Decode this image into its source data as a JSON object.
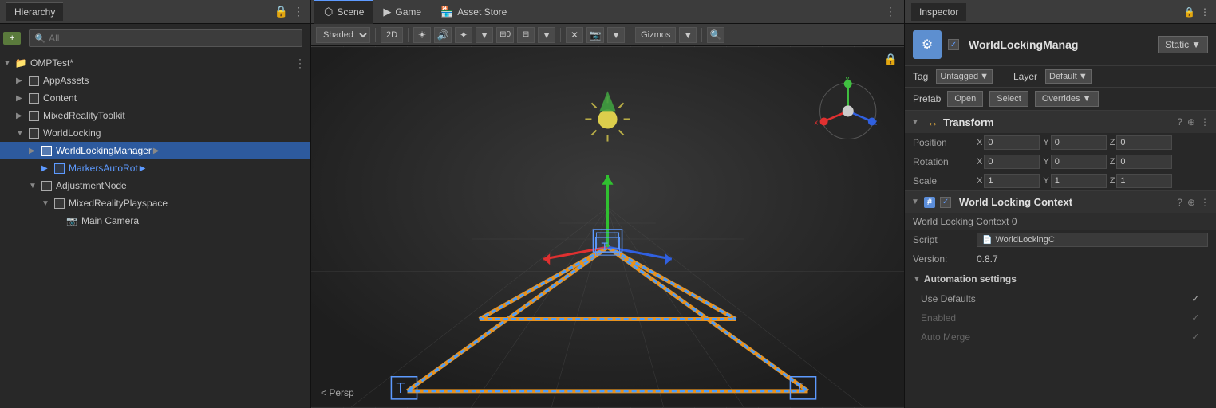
{
  "hierarchy": {
    "tab_label": "Hierarchy",
    "search_placeholder": "All",
    "root_item": "OMPTest*",
    "items": [
      {
        "id": "appassets",
        "label": "AppAssets",
        "depth": 1,
        "has_children": true,
        "type": "folder"
      },
      {
        "id": "content",
        "label": "Content",
        "depth": 1,
        "has_children": true,
        "type": "folder"
      },
      {
        "id": "mixedreality",
        "label": "MixedRealityToolkit",
        "depth": 1,
        "has_children": true,
        "type": "folder"
      },
      {
        "id": "worldlocking",
        "label": "WorldLocking",
        "depth": 1,
        "has_children": true,
        "type": "folder"
      },
      {
        "id": "worldlockingmanager",
        "label": "WorldLockingManager",
        "depth": 2,
        "has_children": true,
        "type": "prefab",
        "selected": true
      },
      {
        "id": "markersautorot",
        "label": "MarkersAutoRot",
        "depth": 3,
        "has_children": true,
        "type": "prefab_blue"
      },
      {
        "id": "adjustmentnode",
        "label": "AdjustmentNode",
        "depth": 2,
        "has_children": true,
        "type": "folder"
      },
      {
        "id": "mixedrealityplayspace",
        "label": "MixedRealityPlayspace",
        "depth": 3,
        "has_children": true,
        "type": "folder"
      },
      {
        "id": "maincamera",
        "label": "Main Camera",
        "depth": 4,
        "has_children": false,
        "type": "camera"
      }
    ]
  },
  "scene": {
    "tabs": [
      {
        "id": "scene",
        "label": "Scene",
        "icon": "⬡",
        "active": true
      },
      {
        "id": "game",
        "label": "Game",
        "icon": "🎮",
        "active": false
      },
      {
        "id": "assetstore",
        "label": "Asset Store",
        "icon": "🏪",
        "active": false
      }
    ],
    "toolbar": {
      "shading": "Shaded",
      "mode_2d": "2D",
      "audio_label": "0",
      "gizmos_label": "Gizmos"
    },
    "perspective_label": "< Persp"
  },
  "inspector": {
    "tab_label": "Inspector",
    "lock_icon": "🔒",
    "object_name": "WorldLockingManag",
    "static_label": "Static",
    "tag_label": "Tag",
    "tag_value": "Untagged",
    "layer_label": "Layer",
    "layer_value": "Default",
    "prefab_label": "Prefab",
    "open_label": "Open",
    "select_label": "Select",
    "overrides_label": "Overrides",
    "transform": {
      "section_name": "Transform",
      "position_label": "Position",
      "rotation_label": "Rotation",
      "scale_label": "Scale",
      "pos_x": "0",
      "pos_y": "0",
      "pos_z": "0",
      "rot_x": "0",
      "rot_y": "0",
      "rot_z": "0",
      "scale_x": "1",
      "scale_y": "1",
      "scale_z": "1"
    },
    "world_locking_context": {
      "section_name": "World Locking Context",
      "script_label": "Script",
      "script_value": "WorldLockingC",
      "version_label": "Version:",
      "version_value": "0.8.7",
      "automation_label": "Automation settings",
      "use_defaults_label": "Use Defaults",
      "enabled_label": "Enabled",
      "auto_merge_label": "Auto Merge"
    }
  }
}
